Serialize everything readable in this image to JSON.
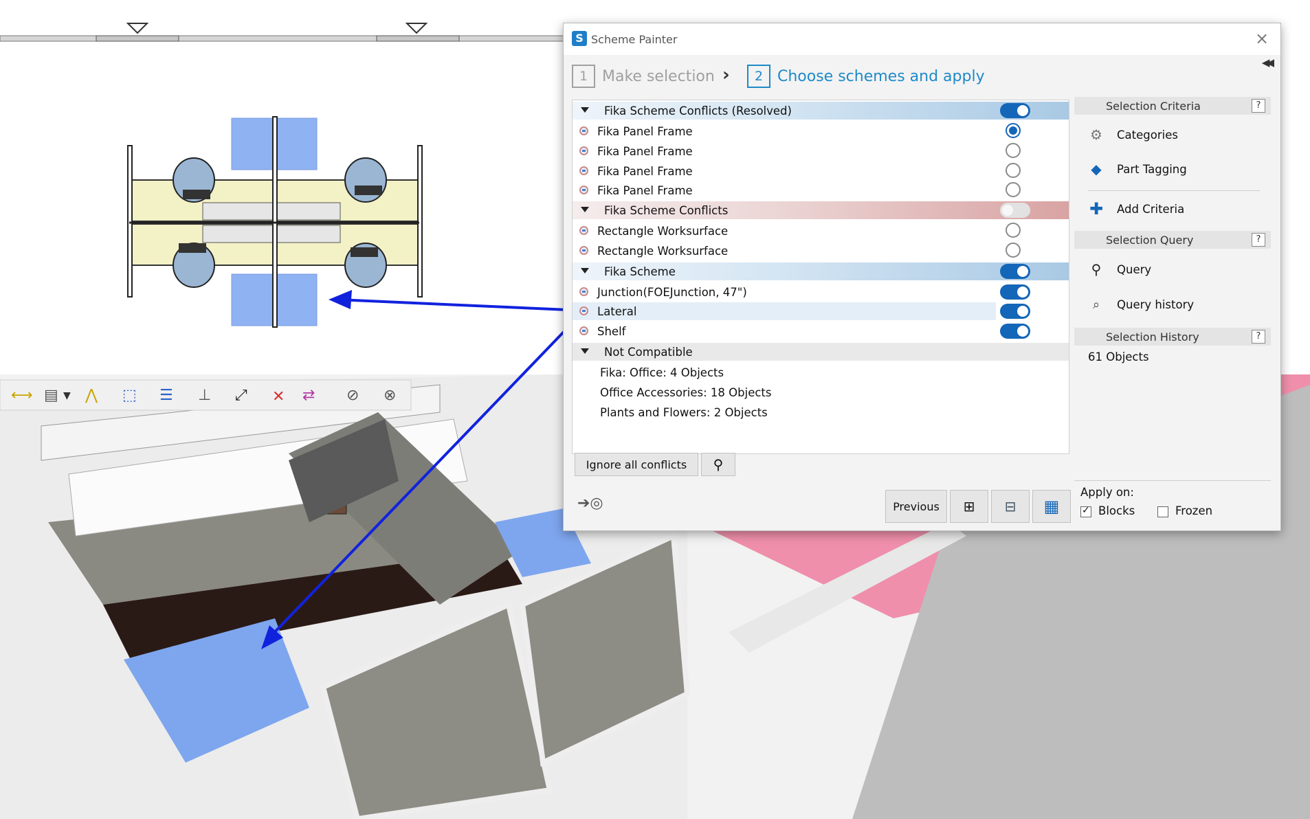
{
  "window": {
    "title": "Scheme Painter"
  },
  "steps": [
    {
      "number": "1",
      "label": "Make selection"
    },
    {
      "number": "2",
      "label": "Choose schemes and apply"
    }
  ],
  "groups": [
    {
      "label": "Fika Scheme Conflicts (Resolved)",
      "toggle": true,
      "items": [
        {
          "label": "Fika Panel Frame",
          "radio": true
        },
        {
          "label": "Fika Panel Frame",
          "radio": false
        },
        {
          "label": "Fika Panel Frame",
          "radio": false
        },
        {
          "label": "Fika Panel Frame",
          "radio": false
        }
      ]
    },
    {
      "label": "Fika Scheme Conflicts",
      "toggle": false,
      "items": [
        {
          "label": "Rectangle Worksurface",
          "radio": false
        },
        {
          "label": "Rectangle Worksurface",
          "radio": false
        }
      ]
    },
    {
      "label": "Fika Scheme",
      "toggle": true,
      "items": [
        {
          "label": "Junction(FOEJunction, 47\")",
          "toggle": true
        },
        {
          "label": "Lateral",
          "toggle": true
        },
        {
          "label": "Shelf",
          "toggle": true
        }
      ]
    }
  ],
  "not_compatible": {
    "label": "Not Compatible",
    "items": [
      "Fika: Office: 4 Objects",
      "Office Accessories: 18 Objects",
      "Plants and Flowers: 2 Objects"
    ]
  },
  "buttons": {
    "ignore_all": "Ignore all conflicts",
    "previous": "Previous"
  },
  "right_panel": {
    "selection_criteria": "Selection Criteria",
    "categories": "Categories",
    "part_tagging": "Part Tagging",
    "add_criteria": "Add Criteria",
    "selection_query": "Selection Query",
    "query": "Query",
    "query_history": "Query history",
    "selection_history": "Selection History",
    "objects_count": "61 Objects",
    "help": "?"
  },
  "apply_on": {
    "label": "Apply on:",
    "blocks": {
      "label": "Blocks",
      "checked": true
    },
    "frozen": {
      "label": "Frozen",
      "checked": false
    }
  }
}
